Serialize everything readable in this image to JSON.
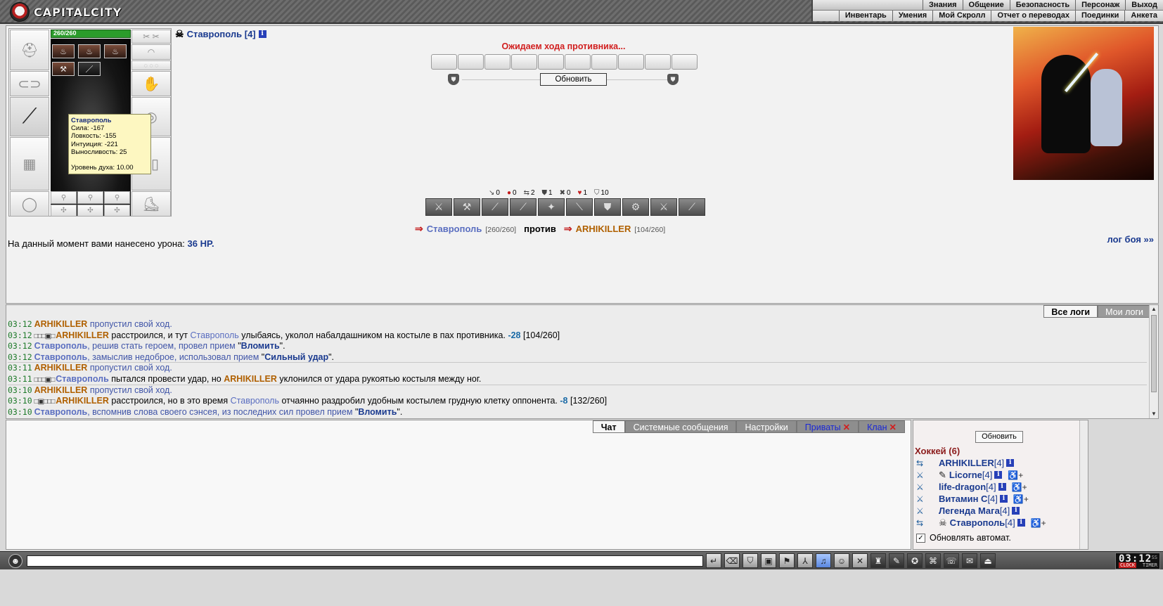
{
  "app": {
    "logo_text": "CAPITALCITY"
  },
  "top_menu": {
    "row1": [
      "Знания",
      "Общение",
      "Безопасность",
      "Персонаж",
      "Выход"
    ],
    "row2": [
      "Инвентарь",
      "Умения",
      "Мой Скролл",
      "Отчет о переводах",
      "Поединки",
      "Анкета"
    ]
  },
  "player": {
    "name": "Ставрополь [4]",
    "hp_text": "260/260",
    "hp_fraction": 1.0
  },
  "tooltip": {
    "name": "Ставрополь",
    "lines": [
      "Сила: -167",
      "Ловкость: -155",
      "Интуиция: -221",
      "Выносливость: 25"
    ],
    "spirit": "Уровень духа: 10.00"
  },
  "battle": {
    "waiting": "Ожидаем хода противника...",
    "refresh_label": "Обновить",
    "counters": [
      {
        "icon": "↘",
        "value": "0",
        "red": false
      },
      {
        "icon": "●",
        "value": "0",
        "red": true
      },
      {
        "icon": "⇆",
        "value": "2",
        "red": false
      },
      {
        "icon": "⛊",
        "value": "1",
        "red": false
      },
      {
        "icon": "✖",
        "value": "0",
        "red": false
      },
      {
        "icon": "♥",
        "value": "1",
        "red": true
      },
      {
        "icon": "⛉",
        "value": "10",
        "red": false
      }
    ],
    "me": {
      "name": "Ставрополь",
      "hp": "[260/260]"
    },
    "vs": "против",
    "opponent": {
      "name": "ARHIKILLER",
      "hp": "[104/260]"
    },
    "damage_prefix": "На данный момент вами нанесено урона:",
    "damage_value": "36 HP.",
    "log_link": "лог боя »»"
  },
  "log": {
    "tabs": [
      "Все логи",
      "Мои логи"
    ],
    "lines": [
      {
        "ts": "03:12",
        "html": "<span class='nm-op'>ARHIKILLER</span> <span class='act'>пропустил свой ход.</span>"
      },
      {
        "ts": "03:12",
        "html": "<span class='boxes'>□□□▣□</span><span class='nm-op'>ARHIKILLER</span> расстроился, и тут <span class='nm-me' style='font-weight:normal'>Ставрополь</span> улыбаясь, уколол набалдашником на костыле в пах противника. <span class='dmg'>-28</span> [104/260]"
      },
      {
        "ts": "03:12",
        "html": "<span class='nm-me'>Ставрополь</span><span class='act'>, решив стать героем, провел прием </span>\"<span class='tech'>Вломить</span>\"."
      },
      {
        "ts": "03:12",
        "html": "<span class='nm-me'>Ставрополь</span><span class='act'>, замыслив недоброе, использовал прием </span>\"<span class='tech'>Сильный удар</span>\".",
        "sep": true
      },
      {
        "ts": "03:11",
        "html": "<span class='nm-op'>ARHIKILLER</span> <span class='act'>пропустил свой ход.</span>"
      },
      {
        "ts": "03:11",
        "html": "<span class='boxes'>□□□▣□</span><span class='nm-me'>Ставрополь</span> пытался провести удар, но <span class='nm-op'>ARHIKILLER</span> уклонился от удара рукоятью костыля между ног.",
        "sep": true
      },
      {
        "ts": "03:10",
        "html": "<span class='nm-op'>ARHIKILLER</span> <span class='act'>пропустил свой ход.</span>"
      },
      {
        "ts": "03:10",
        "html": "<span class='boxes'>□▣□□□</span><span class='nm-op'>ARHIKILLER</span> расстроился, но в это время <span class='nm-me' style='font-weight:normal'>Ставрополь</span> отчаянно раздробил удобным костылем грудную клетку оппонента. <span class='dmg'>-8</span> [132/260]"
      },
      {
        "ts": "03:10",
        "html": "<span class='nm-me'>Ставрополь</span><span class='act'>, вспомнив слова своего сэнсея, из последних сил провел прием </span>\"<span class='tech'>Вломить</span>\"."
      }
    ]
  },
  "chat": {
    "tabs": [
      {
        "label": "Чат",
        "style": "active",
        "close": false
      },
      {
        "label": "Системные сообщения",
        "style": "inactive",
        "close": false
      },
      {
        "label": "Настройки",
        "style": "inactive",
        "close": false
      },
      {
        "label": "Приваты",
        "style": "blue",
        "close": true
      },
      {
        "label": "Клан",
        "style": "blue",
        "close": true
      }
    ]
  },
  "online": {
    "refresh_label": "Обновить",
    "group": "Хоккей (6)",
    "players": [
      {
        "name": "ARHIKILLER",
        "lvl": "[4]",
        "prefix": "",
        "add": false
      },
      {
        "name": "Licorne",
        "lvl": "[4]",
        "prefix": "✎",
        "add": true
      },
      {
        "name": "life-dragon",
        "lvl": "[4]",
        "prefix": "",
        "add": true
      },
      {
        "name": "Витамин С",
        "lvl": "[4]",
        "prefix": "",
        "add": true
      },
      {
        "name": "Легенда Мага",
        "lvl": "[4]",
        "prefix": "",
        "add": false
      },
      {
        "name": "Ставрополь",
        "lvl": "[4]",
        "prefix": "☠",
        "add": true
      }
    ],
    "auto_label": "Обновлять автомат."
  },
  "clock": {
    "time": "03:12",
    "ss": "SS",
    "label1": "CLOCK",
    "label2": "TIMER"
  }
}
